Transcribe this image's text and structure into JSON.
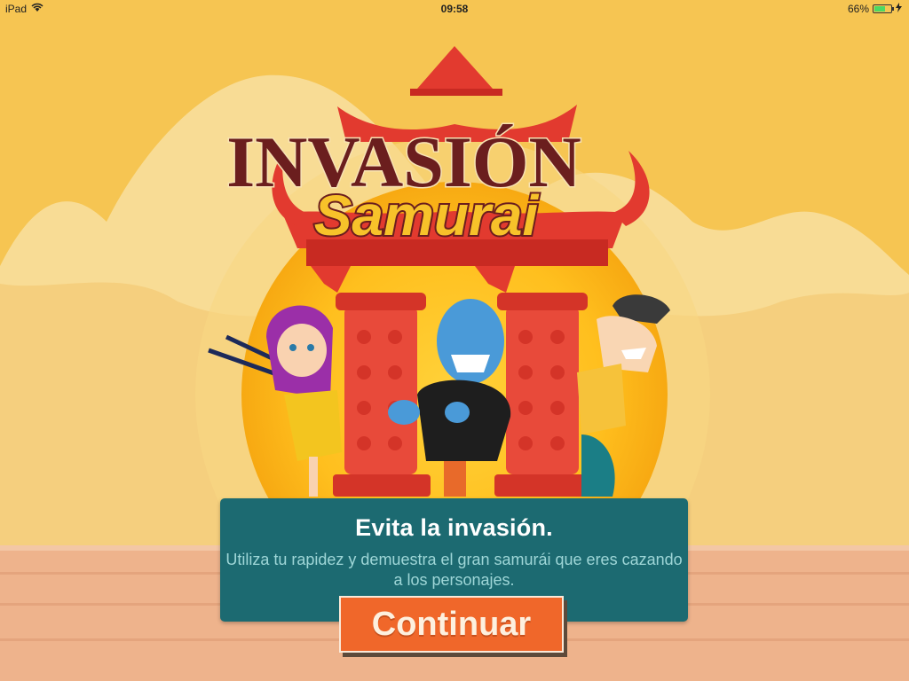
{
  "status_bar": {
    "device": "iPad",
    "time": "09:58",
    "battery_text": "66%",
    "battery_level": 0.66,
    "wifi_icon": "wifi-icon",
    "charging_icon": "charging-bolt-icon"
  },
  "game": {
    "title_line1": "INVASIÓN",
    "title_line2": "Samurai",
    "colors": {
      "sky": "#f6c552",
      "temple_red": "#e23a2f",
      "panel": "#1c6a71",
      "button": "#f0672a",
      "title_brown": "#6b1e1e",
      "title_yellow": "#f7c22a"
    }
  },
  "dialog": {
    "headline": "Evita la invasión.",
    "body": "Utiliza tu rapidez y demuestra el gran samurái que eres cazando a los personajes."
  },
  "button": {
    "continue_label": "Continuar"
  }
}
